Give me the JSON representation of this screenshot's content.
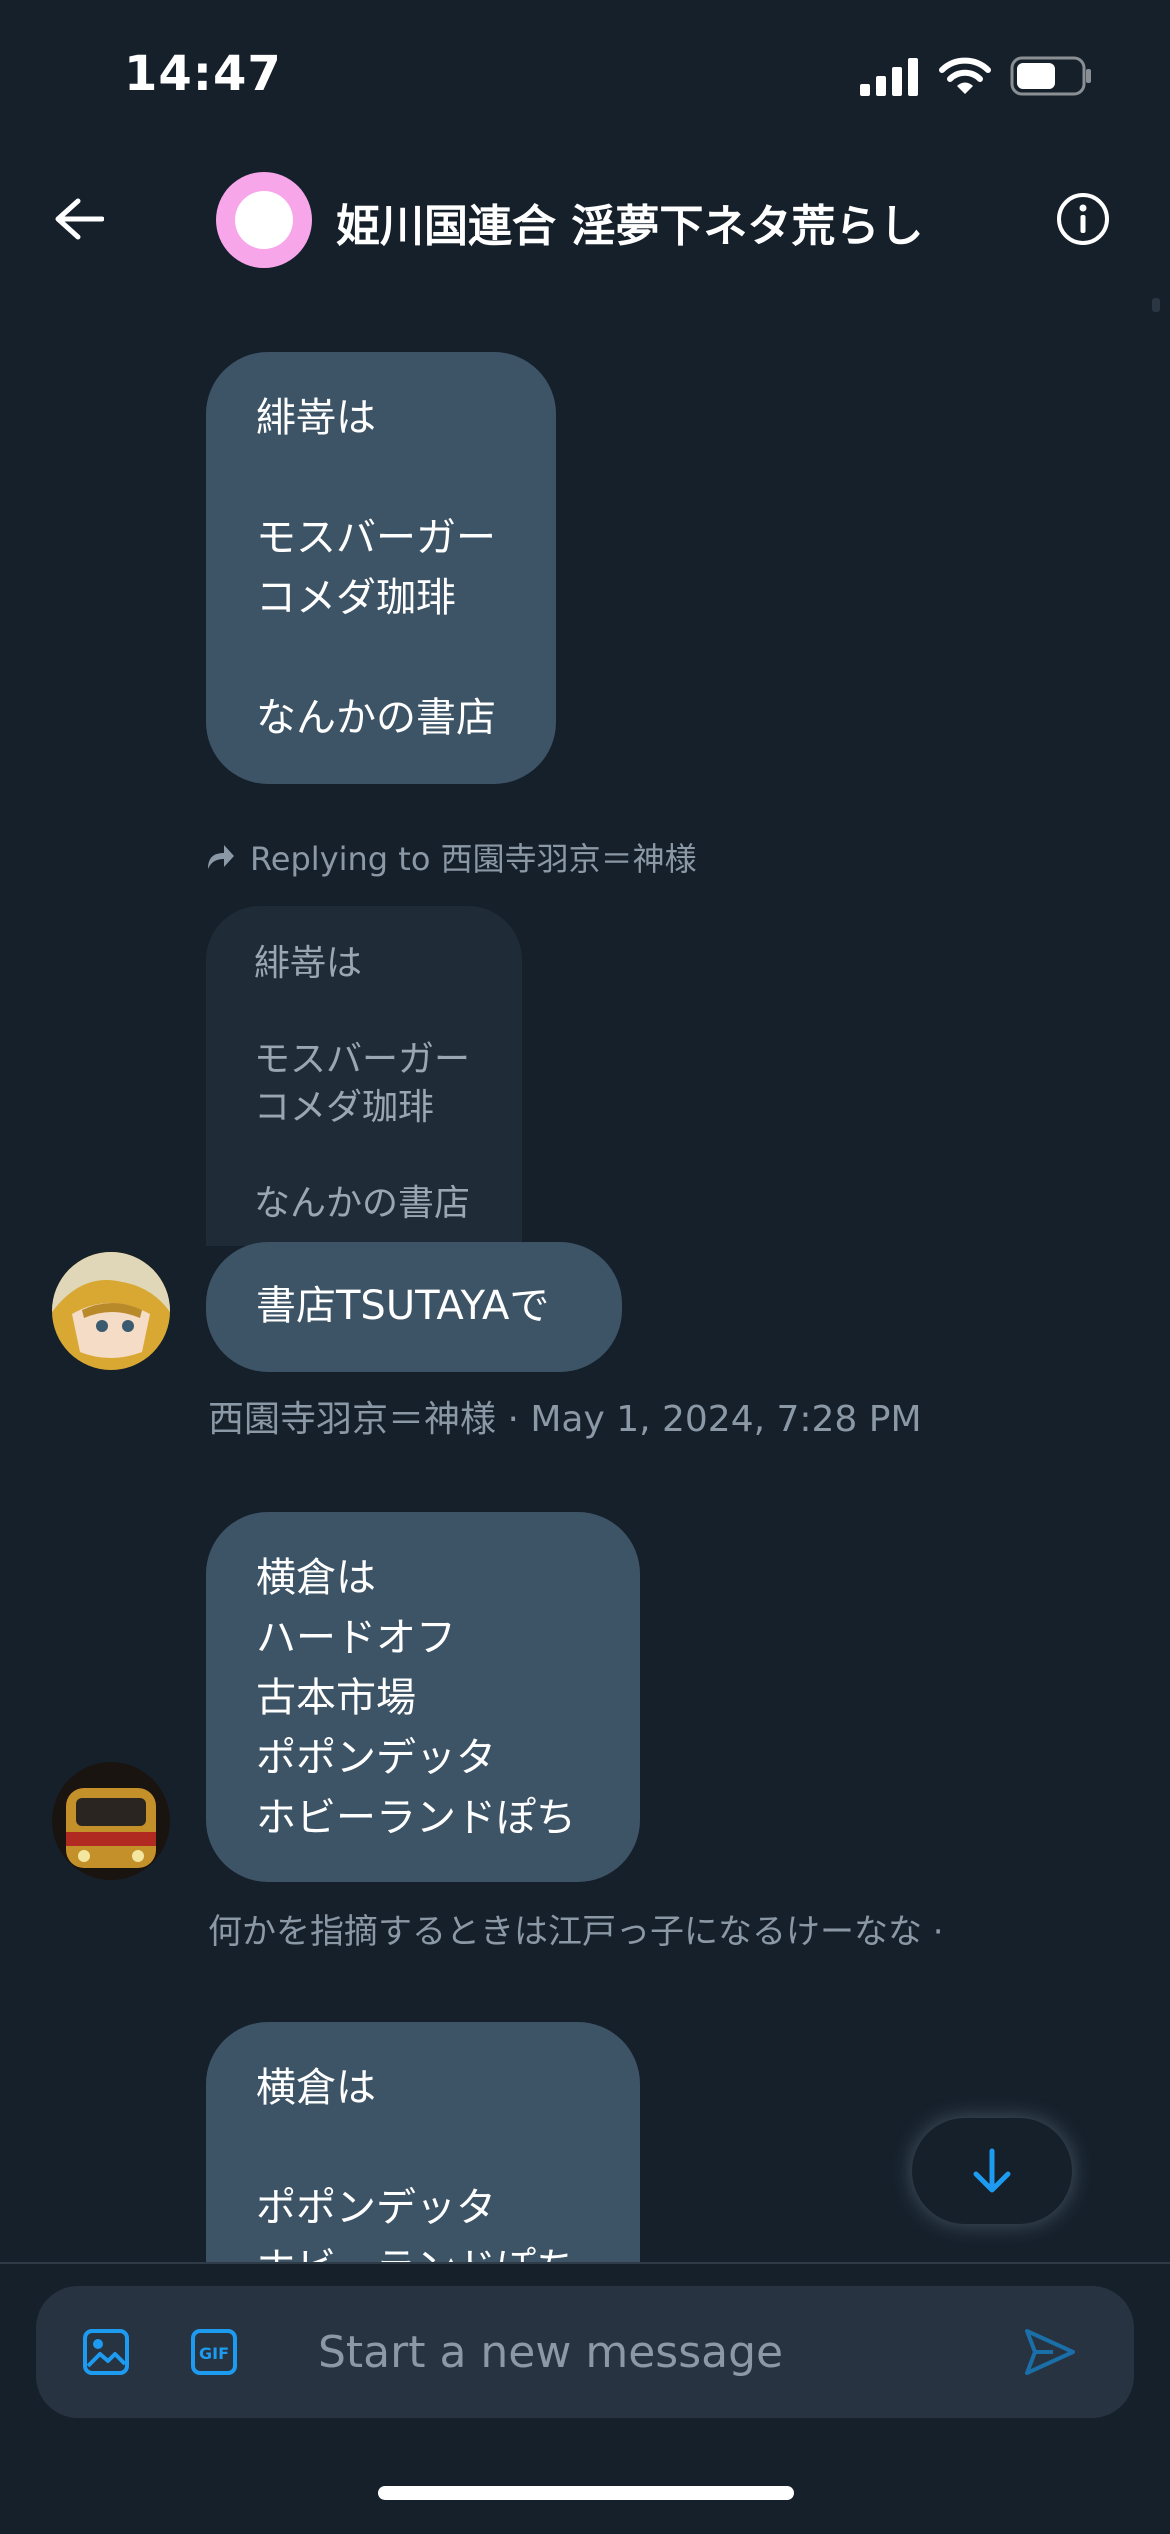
{
  "status_bar": {
    "time": "14:47",
    "battery_level": 0.62
  },
  "header": {
    "title": "姫川国連合 淫夢下ネタ荒らし",
    "avatar_color": "#f7a6e9"
  },
  "messages": [
    {
      "lines": [
        "緋嵜は",
        "",
        "モスバーガー",
        "コメダ珈琲",
        "",
        "なんかの書店"
      ]
    },
    {
      "reply_label": "Replying to 西園寺羽京＝神様",
      "quoted_lines": [
        "緋嵜は",
        "",
        "モスバーガー",
        "コメダ珈琲",
        "",
        "なんかの書店"
      ],
      "lines": [
        "書店TSUTAYAで"
      ],
      "meta": "西園寺羽京＝神様 · May 1, 2024, 7:28 PM"
    },
    {
      "lines": [
        "横倉は",
        "ハードオフ",
        "古本市場",
        "ポポンデッタ",
        "ホビーランドぽち"
      ],
      "meta": "何かを指摘するときは江戸っ子になるけーなな ·"
    },
    {
      "lines": [
        "横倉は",
        "",
        "ポポンデッタ",
        "ホビーランドぽち"
      ]
    }
  ],
  "compose": {
    "placeholder": "Start a new message",
    "gif_label": "GIF"
  },
  "colors": {
    "background": "#15202b",
    "bubble": "#3d5466",
    "accent": "#1d9bf0"
  },
  "icons": [
    "back-arrow-icon",
    "info-icon",
    "reply-arrow-icon",
    "arrow-down-icon",
    "image-icon",
    "gif-icon",
    "send-icon"
  ]
}
